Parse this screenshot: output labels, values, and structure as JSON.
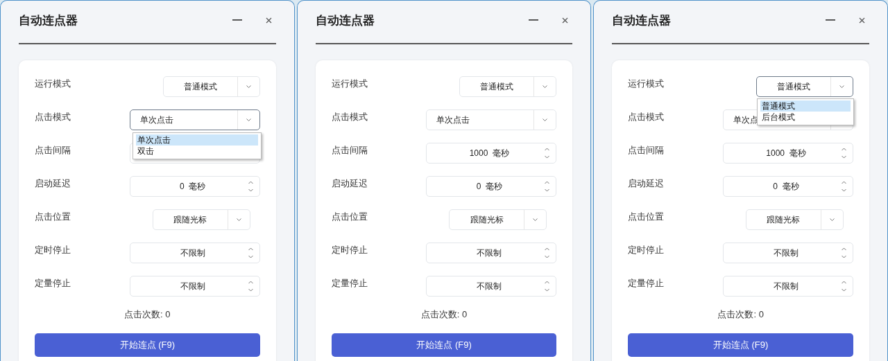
{
  "windows": [
    {
      "title": "自动连点器",
      "rows": [
        {
          "label": "运行模式",
          "kind": "combo",
          "value": "普通模式"
        },
        {
          "label": "点击模式",
          "kind": "combo",
          "value": "单次点击",
          "focused": true,
          "dropdown": [
            {
              "label": "单次点击",
              "selected": true
            },
            {
              "label": "双击",
              "selected": false
            }
          ]
        },
        {
          "label": "点击间隔",
          "kind": "spin"
        },
        {
          "label": "启动延迟",
          "kind": "spin",
          "value": "0  毫秒"
        },
        {
          "label": "点击位置",
          "kind": "combo",
          "value": "跟随光标"
        },
        {
          "label": "定时停止",
          "kind": "spin",
          "value": "不限制"
        },
        {
          "label": "定量停止",
          "kind": "spin",
          "value": "不限制"
        }
      ],
      "count": "点击次数: 0",
      "start_button": "开始连点 (F9)"
    },
    {
      "title": "自动连点器",
      "rows": [
        {
          "label": "运行模式",
          "kind": "combo",
          "value": "普通模式"
        },
        {
          "label": "点击模式",
          "kind": "combo",
          "value": "单次点击"
        },
        {
          "label": "点击间隔",
          "kind": "spin",
          "value": "1000  毫秒"
        },
        {
          "label": "启动延迟",
          "kind": "spin",
          "value": "0  毫秒"
        },
        {
          "label": "点击位置",
          "kind": "combo",
          "value": "跟随光标"
        },
        {
          "label": "定时停止",
          "kind": "spin",
          "value": "不限制"
        },
        {
          "label": "定量停止",
          "kind": "spin",
          "value": "不限制"
        }
      ],
      "count": "点击次数: 0",
      "start_button": "开始连点 (F9)"
    },
    {
      "title": "自动连点器",
      "rows": [
        {
          "label": "运行模式",
          "kind": "combo",
          "value": "普通模式",
          "focused": true,
          "dropdown": [
            {
              "label": "普通模式",
              "selected": true
            },
            {
              "label": "后台模式",
              "selected": false
            }
          ]
        },
        {
          "label": "点击模式",
          "kind": "combo",
          "value": "单次点"
        },
        {
          "label": "点击间隔",
          "kind": "spin",
          "value": "1000  毫秒"
        },
        {
          "label": "启动延迟",
          "kind": "spin",
          "value": "0  毫秒"
        },
        {
          "label": "点击位置",
          "kind": "combo",
          "value": "跟随光标"
        },
        {
          "label": "定时停止",
          "kind": "spin",
          "value": "不限制"
        },
        {
          "label": "定量停止",
          "kind": "spin",
          "value": "不限制"
        }
      ],
      "count": "点击次数: 0",
      "start_button": "开始连点 (F9)"
    }
  ]
}
